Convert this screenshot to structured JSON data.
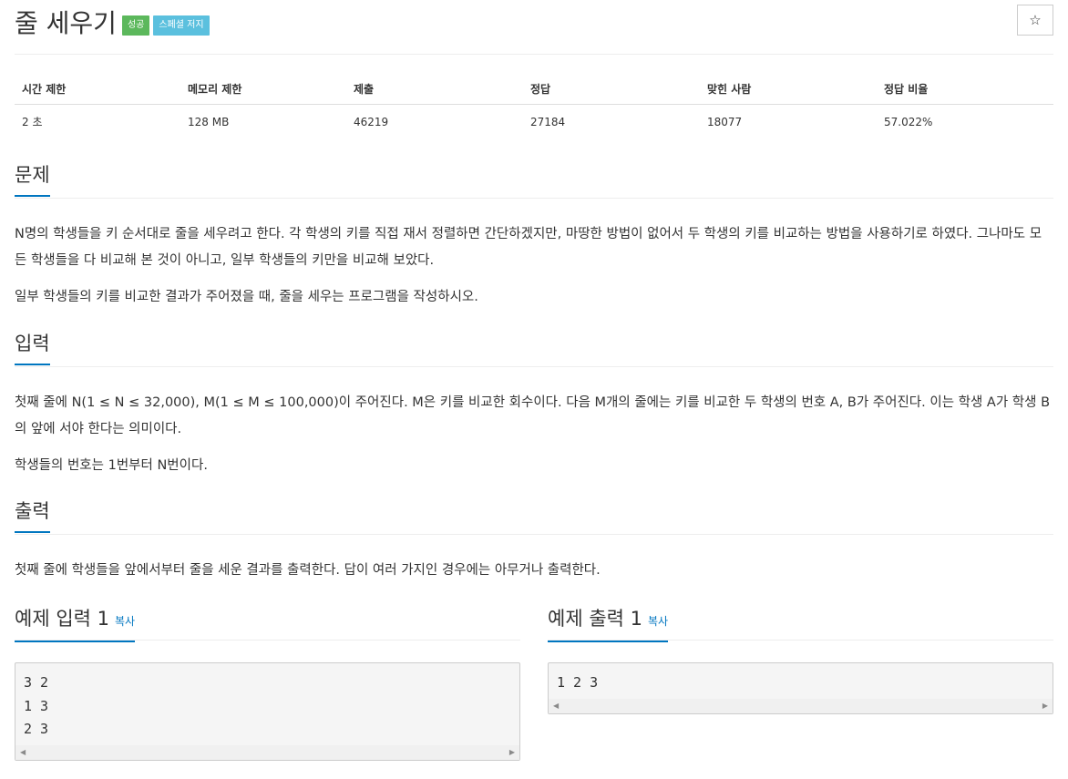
{
  "problem": {
    "title": "줄 세우기",
    "badges": {
      "success": "성공",
      "special": "스페셜 저지"
    },
    "star_icon": "☆"
  },
  "info_table": {
    "headers": [
      "시간 제한",
      "메모리 제한",
      "제출",
      "정답",
      "맞힌 사람",
      "정답 비율"
    ],
    "values": [
      "2 초",
      "128 MB",
      "46219",
      "27184",
      "18077",
      "57.022%"
    ]
  },
  "sections": {
    "problem": {
      "heading": "문제",
      "paragraphs": [
        "N명의 학생들을 키 순서대로 줄을 세우려고 한다. 각 학생의 키를 직접 재서 정렬하면 간단하겠지만, 마땅한 방법이 없어서 두 학생의 키를 비교하는 방법을 사용하기로 하였다. 그나마도 모든 학생들을 다 비교해 본 것이 아니고, 일부 학생들의 키만을 비교해 보았다.",
        "일부 학생들의 키를 비교한 결과가 주어졌을 때, 줄을 세우는 프로그램을 작성하시오."
      ]
    },
    "input": {
      "heading": "입력",
      "paragraphs": [
        "첫째 줄에 N(1 ≤ N ≤ 32,000), M(1 ≤ M ≤ 100,000)이 주어진다. M은 키를 비교한 회수이다. 다음 M개의 줄에는 키를 비교한 두 학생의 번호 A, B가 주어진다. 이는 학생 A가 학생 B의 앞에 서야 한다는 의미이다.",
        "학생들의 번호는 1번부터 N번이다."
      ]
    },
    "output": {
      "heading": "출력",
      "paragraphs": [
        "첫째 줄에 학생들을 앞에서부터 줄을 세운 결과를 출력한다. 답이 여러 가지인 경우에는 아무거나 출력한다."
      ]
    }
  },
  "samples": {
    "input": {
      "heading": "예제 입력 1",
      "copy": "복사",
      "text": "3 2\n1 3\n2 3"
    },
    "output": {
      "heading": "예제 출력 1",
      "copy": "복사",
      "text": "1 2 3"
    }
  },
  "colors": {
    "accent": "#0076c0",
    "success": "#5cb85c",
    "info": "#5bc0de"
  }
}
